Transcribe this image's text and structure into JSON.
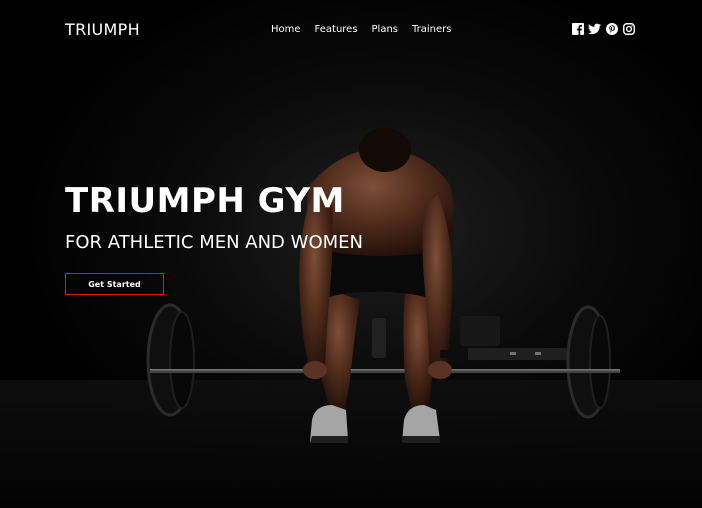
{
  "nav": {
    "brand": "TRIUMPH",
    "links": [
      {
        "label": "Home"
      },
      {
        "label": "Features"
      },
      {
        "label": "Plans"
      },
      {
        "label": "Trainers"
      }
    ],
    "socials": [
      "facebook-icon",
      "twitter-icon",
      "pinterest-icon",
      "instagram-icon"
    ]
  },
  "hero": {
    "title": "TRIUMPH GYM",
    "subtitle": "FOR ATHLETIC MEN AND WOMEN",
    "cta_label": "Get Started",
    "image": "man-lifting-barbell-photo"
  },
  "colors": {
    "background": "#000000",
    "text": "#ffffff",
    "accent": "#d11a1a"
  }
}
